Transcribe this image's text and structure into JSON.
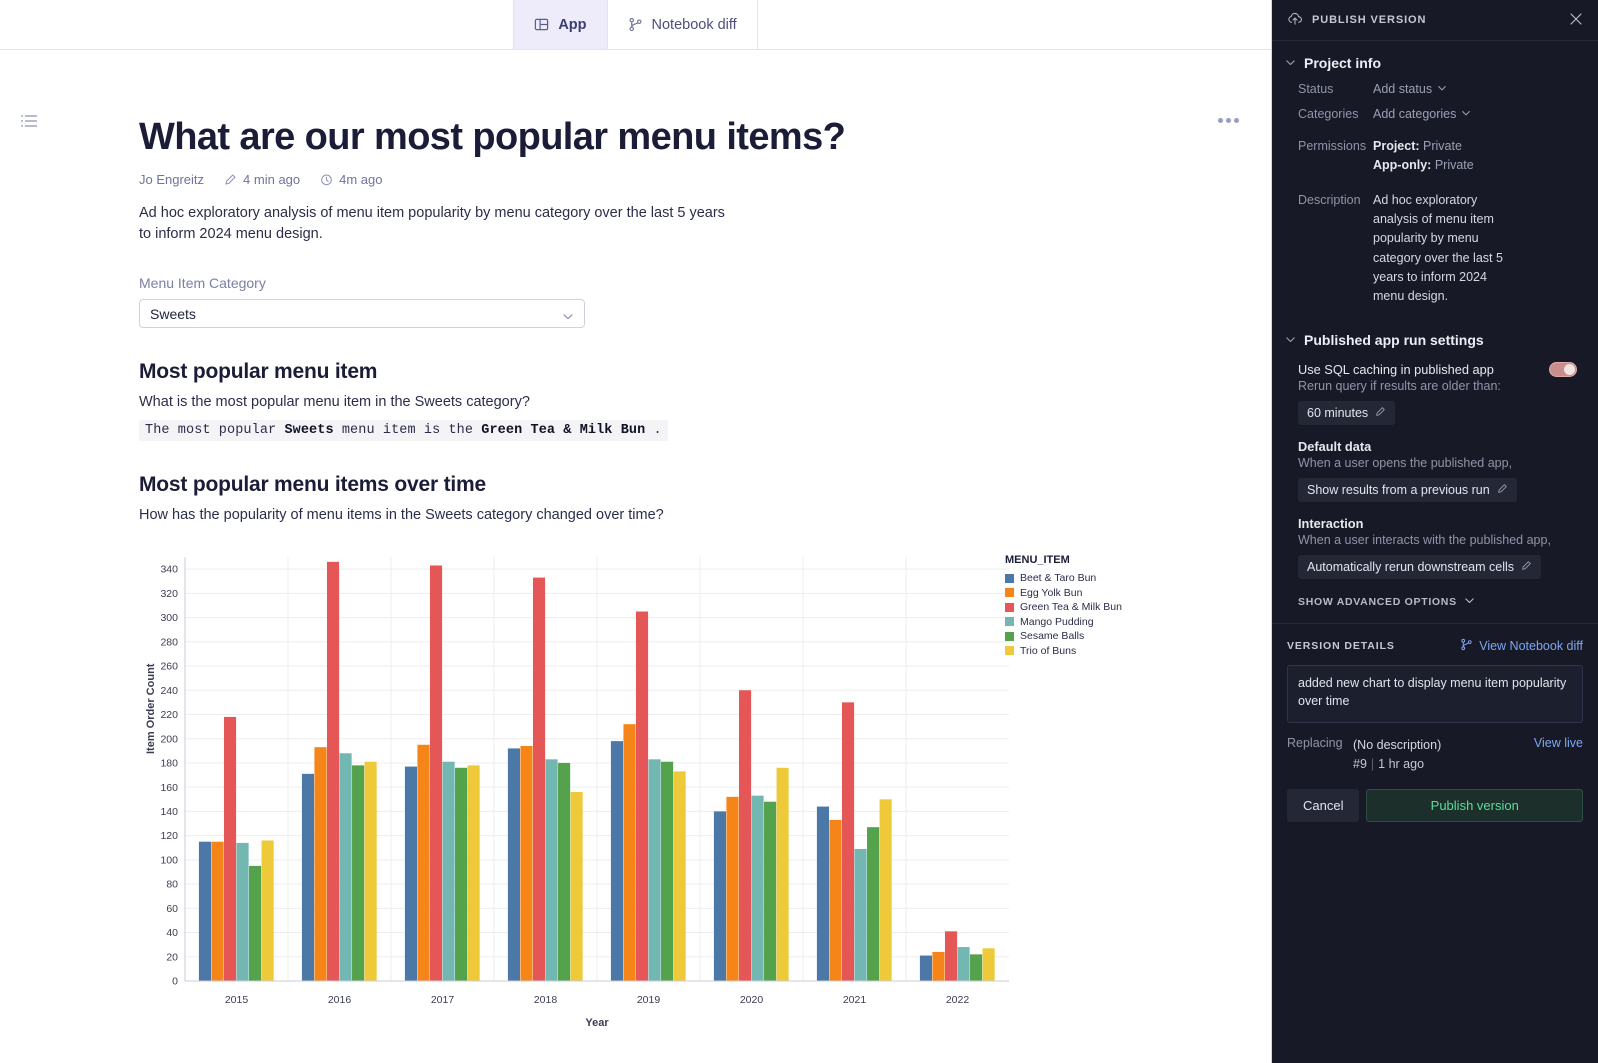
{
  "tabs": [
    {
      "label": "App",
      "icon": "app-panel-icon",
      "active": true
    },
    {
      "label": "Notebook diff",
      "icon": "branch-diff-icon",
      "active": false
    }
  ],
  "doc": {
    "title": "What are our most popular menu items?",
    "author": "Jo Engreitz",
    "edited": "4 min ago",
    "ran": "4m ago",
    "description": "Ad hoc exploratory analysis of menu item popularity by menu category over the last 5 years to inform 2024 menu design.",
    "filter_label": "Menu Item Category",
    "filter_value": "Sweets",
    "section1_heading": "Most popular menu item",
    "section1_question": "What is the most popular menu item in the Sweets category?",
    "answer_prefix": "The most popular ",
    "answer_category": "Sweets",
    "answer_middle": " menu item is the ",
    "answer_item": "Green Tea & Milk Bun",
    "answer_suffix": " .",
    "section2_heading": "Most popular menu items over time",
    "section2_question": "How has the popularity of menu items in the Sweets category changed over time?"
  },
  "chart_data": {
    "type": "bar",
    "title": "",
    "xlabel": "Year",
    "ylabel": "Item Order Count",
    "legend_title": "MENU_ITEM",
    "legend_position": "right",
    "grid": true,
    "ylim": [
      0,
      350
    ],
    "yticks": [
      0,
      20,
      40,
      60,
      80,
      100,
      120,
      140,
      160,
      180,
      200,
      220,
      240,
      260,
      280,
      300,
      320,
      340
    ],
    "categories": [
      "2015",
      "2016",
      "2017",
      "2018",
      "2019",
      "2020",
      "2021",
      "2022"
    ],
    "series": [
      {
        "name": "Beet & Taro Bun",
        "color": "#4c78a8",
        "values": [
          115,
          171,
          177,
          192,
          198,
          140,
          144,
          21
        ]
      },
      {
        "name": "Egg Yolk Bun",
        "color": "#f58518",
        "values": [
          115,
          193,
          195,
          194,
          212,
          152,
          133,
          24
        ]
      },
      {
        "name": "Green Tea & Milk Bun",
        "color": "#e45756",
        "values": [
          218,
          346,
          343,
          333,
          305,
          240,
          230,
          41
        ]
      },
      {
        "name": "Mango Pudding",
        "color": "#72b7b2",
        "values": [
          114,
          188,
          181,
          183,
          183,
          153,
          109,
          28
        ]
      },
      {
        "name": "Sesame Balls",
        "color": "#54a24b",
        "values": [
          95,
          178,
          176,
          180,
          181,
          148,
          127,
          22
        ]
      },
      {
        "name": "Trio of Buns",
        "color": "#eeca3b",
        "values": [
          116,
          181,
          178,
          156,
          173,
          176,
          150,
          27
        ]
      }
    ]
  },
  "panel": {
    "header_title": "PUBLISH VERSION",
    "project_info": {
      "heading": "Project info",
      "status_label": "Status",
      "status_value": "Add status",
      "categories_label": "Categories",
      "categories_value": "Add categories",
      "permissions_label": "Permissions",
      "permissions_project_key": "Project:",
      "permissions_project_value": "Private",
      "permissions_apponly_key": "App-only:",
      "permissions_apponly_value": "Private",
      "description_label": "Description",
      "description_value": "Ad hoc exploratory analysis of menu item popularity by menu category over the last 5 years to inform 2024 menu design."
    },
    "run_settings": {
      "heading": "Published app run settings",
      "sql_caching_label": "Use SQL caching in published app",
      "sql_caching_on": true,
      "rerun_hint": "Rerun query if results are older than:",
      "rerun_value": "60 minutes",
      "default_data_title": "Default data",
      "default_data_hint": "When a user opens the published app,",
      "default_data_value": "Show results from a previous run",
      "interaction_title": "Interaction",
      "interaction_hint": "When a user interacts with the published app,",
      "interaction_value": "Automatically rerun downstream cells",
      "advanced_label": "SHOW ADVANCED OPTIONS"
    },
    "version_details": {
      "heading": "VERSION DETAILS",
      "diff_link": "View Notebook diff",
      "note": "added new chart to display menu item popularity over time",
      "replacing_label": "Replacing",
      "replacing_desc": "(No description)",
      "replacing_number": "#9",
      "replacing_time": "1 hr ago",
      "view_live": "View live",
      "cancel_label": "Cancel",
      "publish_label": "Publish version"
    }
  }
}
